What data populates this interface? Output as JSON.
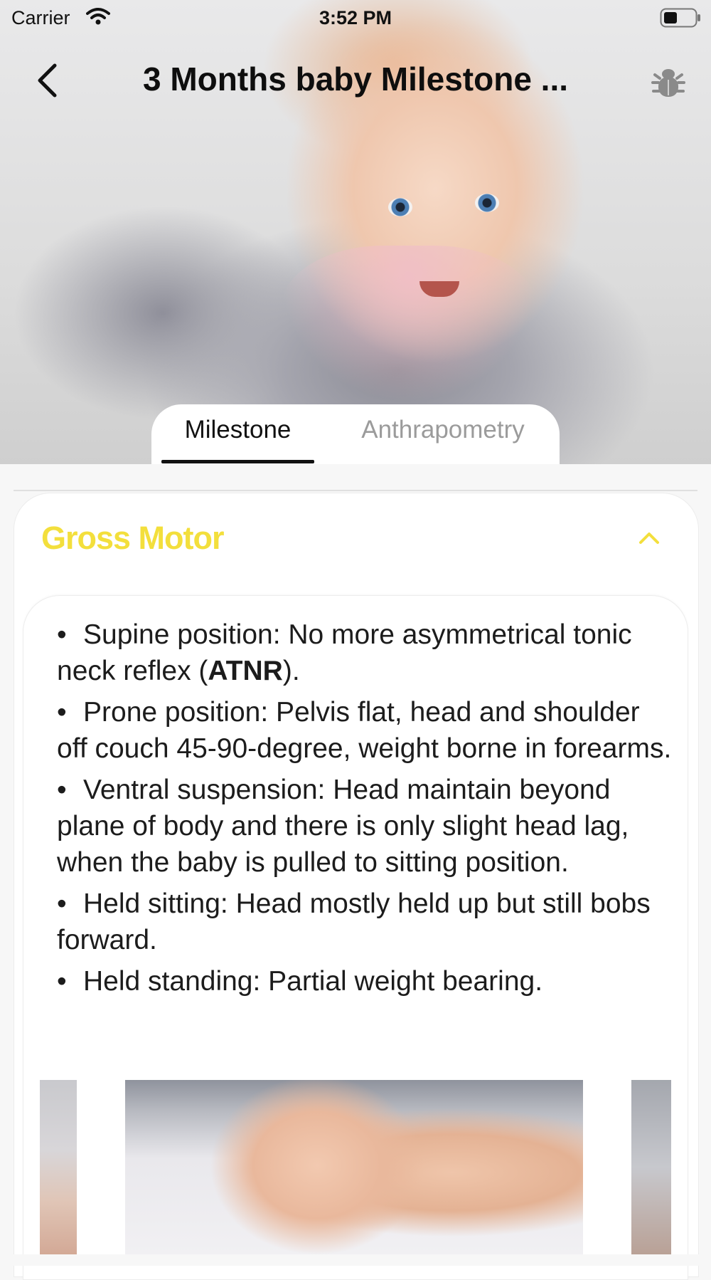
{
  "status_bar": {
    "carrier": "Carrier",
    "time": "3:52 PM"
  },
  "nav": {
    "title": "3 Months baby Milestone ..."
  },
  "tabs": [
    {
      "label": "Milestone",
      "selected": true
    },
    {
      "label": "Anthrapometry",
      "selected": false
    }
  ],
  "section": {
    "title": "Gross Motor",
    "expanded": true,
    "items": [
      {
        "bullet": "•",
        "pre": "Supine position: No more asymmetrical tonic neck reflex (",
        "bold": "ATNR",
        "post": ")."
      },
      {
        "bullet": "•",
        "text": "Prone position: Pelvis flat, head and shoulder off couch 45-90-degree, weight borne in forearms."
      },
      {
        "bullet": "•",
        "text": "Ventral suspension: Head maintain beyond plane of body and there is only slight head lag, when the baby is pulled to sitting position."
      },
      {
        "bullet": "•",
        "text": "Held sitting: Head mostly held up but still bobs forward."
      },
      {
        "bullet": "•",
        "text": "Held standing: Partial weight bearing."
      }
    ]
  },
  "colors": {
    "section_title": "#f3df3c",
    "tab_active": "#111111",
    "tab_inactive": "#9b9b9b"
  },
  "icons": {
    "back": "chevron-left-icon",
    "bug": "bug-icon",
    "collapse": "chevron-up-icon"
  }
}
